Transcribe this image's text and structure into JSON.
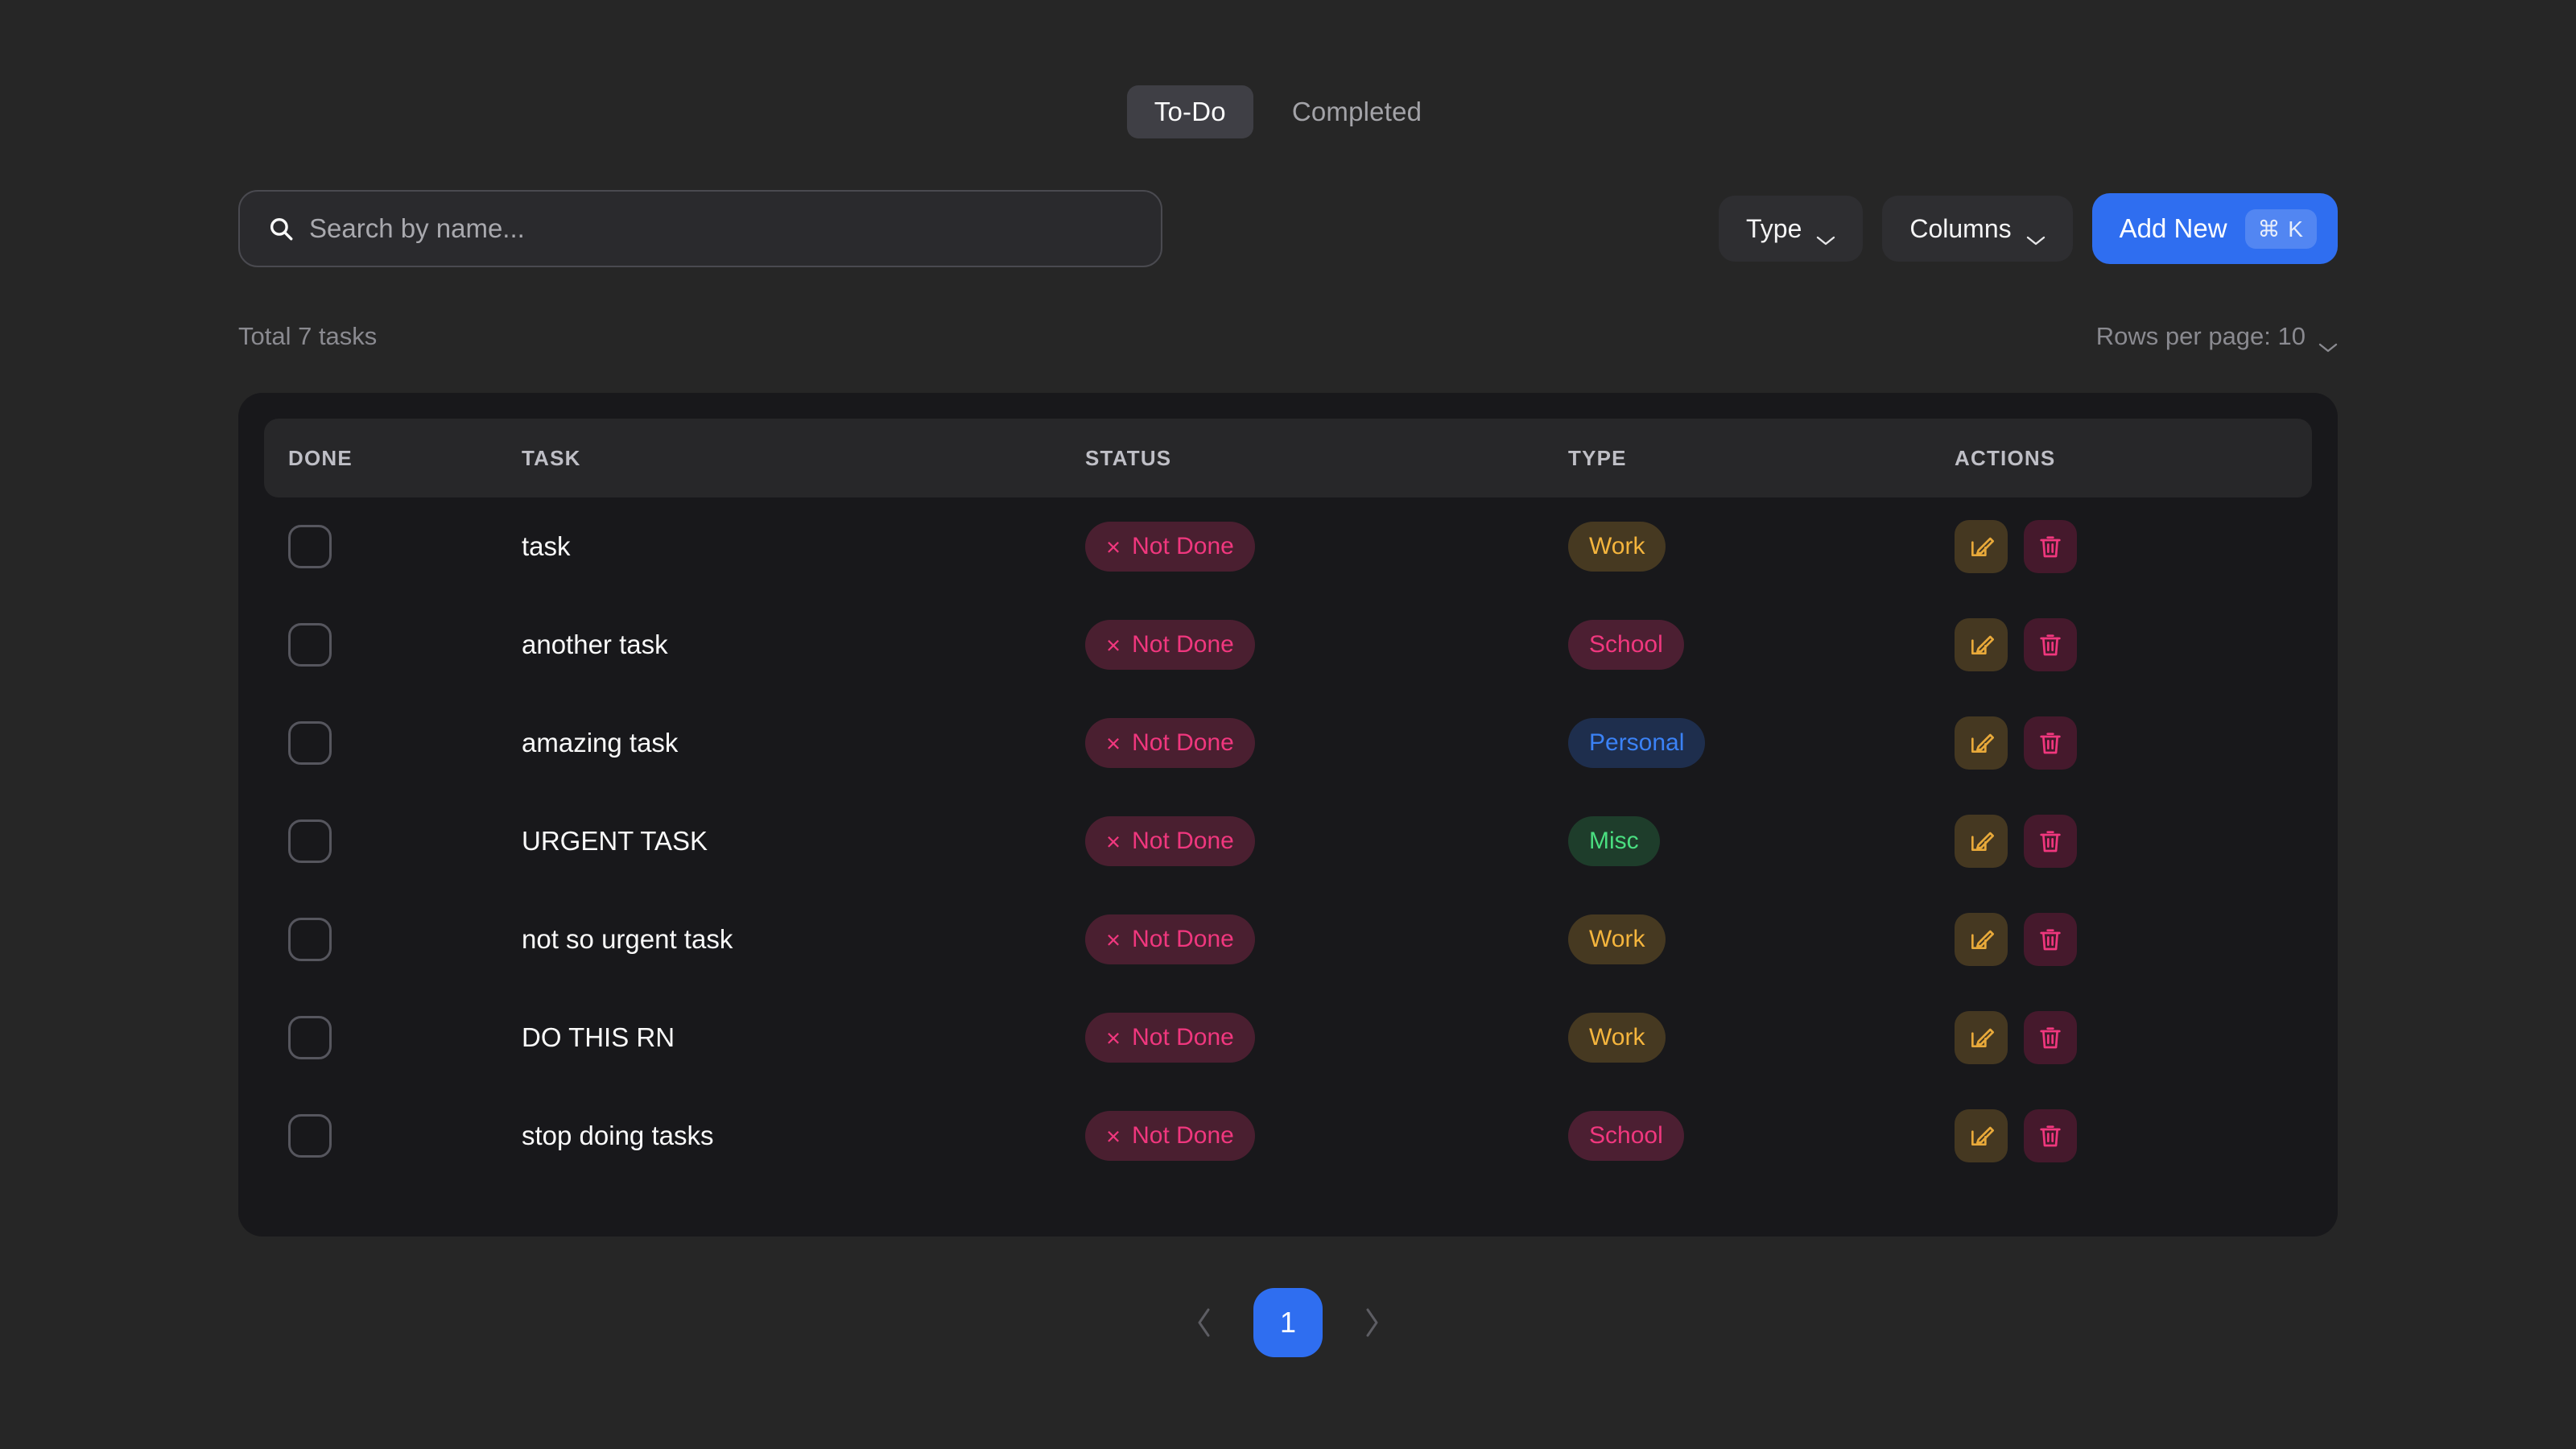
{
  "tabs": [
    {
      "label": "To-Do",
      "active": true
    },
    {
      "label": "Completed",
      "active": false
    }
  ],
  "search": {
    "placeholder": "Search by name...",
    "value": "",
    "icon": "search-icon"
  },
  "toolbar": {
    "type_filter_label": "Type",
    "columns_label": "Columns",
    "add_new_label": "Add New",
    "add_new_shortcut": "⌘ K",
    "accent_color": "#2f6ef0"
  },
  "meta": {
    "total_label": "Total 7 tasks",
    "rows_per_page_label": "Rows per page: 10"
  },
  "table": {
    "columns": [
      "DONE",
      "TASK",
      "STATUS",
      "TYPE",
      "ACTIONS"
    ],
    "rows": [
      {
        "done": false,
        "task": "task",
        "status": "Not Done",
        "type": "Work",
        "type_class": "type-work"
      },
      {
        "done": false,
        "task": "another task",
        "status": "Not Done",
        "type": "School",
        "type_class": "type-school"
      },
      {
        "done": false,
        "task": "amazing task",
        "status": "Not Done",
        "type": "Personal",
        "type_class": "type-personal"
      },
      {
        "done": false,
        "task": "URGENT TASK",
        "status": "Not Done",
        "type": "Misc",
        "type_class": "type-misc"
      },
      {
        "done": false,
        "task": "not so urgent task",
        "status": "Not Done",
        "type": "Work",
        "type_class": "type-work"
      },
      {
        "done": false,
        "task": "DO THIS RN",
        "status": "Not Done",
        "type": "Work",
        "type_class": "type-work"
      },
      {
        "done": false,
        "task": "stop doing tasks",
        "status": "Not Done",
        "type": "School",
        "type_class": "type-school"
      }
    ],
    "status_icon": "×",
    "edit_icon": "edit-icon",
    "delete_icon": "trash-icon"
  },
  "pagination": {
    "prev_label": "‹",
    "next_label": "›",
    "current_page": "1"
  }
}
